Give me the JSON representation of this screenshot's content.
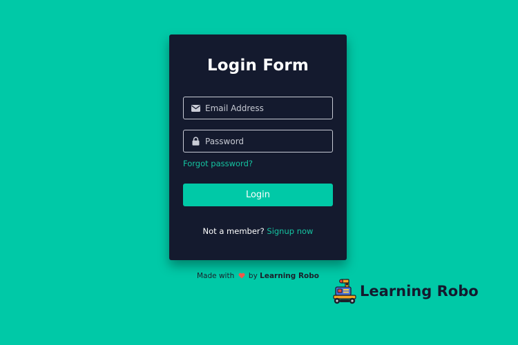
{
  "form": {
    "title": "Login Form",
    "email_placeholder": "Email Address",
    "password_placeholder": "Password",
    "forgot_link": "Forgot password?",
    "login_button": "Login",
    "signup_prompt": "Not a member?",
    "signup_link": "Signup now"
  },
  "footer": {
    "made_with": "Made with",
    "by": "by",
    "author": "Learning Robo"
  },
  "brand": {
    "name": "Learning Robo"
  },
  "colors": {
    "background": "#00c9a7",
    "card": "#141a2e",
    "accent": "#14c4a1",
    "heart": "#f0584a"
  },
  "icons": {
    "email": "envelope-icon",
    "password": "lock-icon",
    "heart": "heart-icon",
    "brand": "robot-logo-icon"
  }
}
